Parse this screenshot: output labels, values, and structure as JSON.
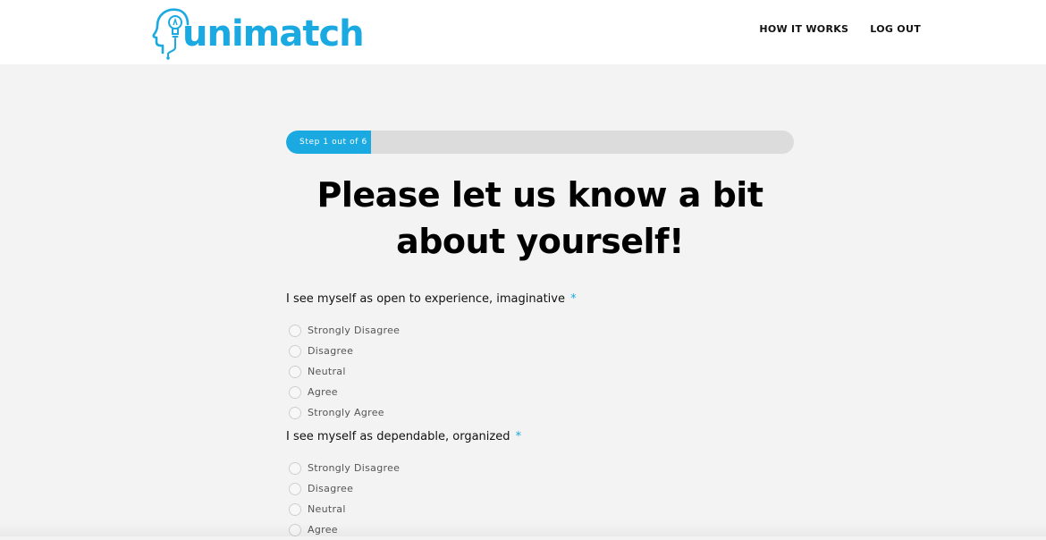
{
  "brand": {
    "logo_text": "unimatch",
    "accent_color": "#1aa9e1",
    "logo_icon": "head-lightbulb-icon"
  },
  "nav": {
    "items": [
      {
        "label": "HOW IT WORKS"
      },
      {
        "label": "LOG OUT"
      }
    ]
  },
  "progress": {
    "label": "Step 1 out of 6",
    "current_step": 1,
    "total_steps": 6,
    "fraction": 0.1667
  },
  "page_title": "Please let us know a bit about yourself!",
  "questions": [
    {
      "label": "I see myself as open to experience, imaginative",
      "required_marker": "*",
      "options": [
        "Strongly Disagree",
        "Disagree",
        "Neutral",
        "Agree",
        "Strongly Agree"
      ]
    },
    {
      "label": "I see myself as dependable, organized",
      "required_marker": "*",
      "options": [
        "Strongly Disagree",
        "Disagree",
        "Neutral",
        "Agree"
      ]
    }
  ]
}
